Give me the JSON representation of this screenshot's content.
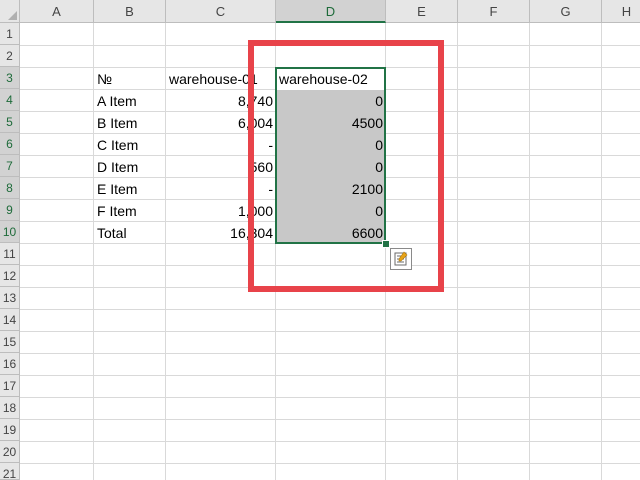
{
  "columns": [
    "A",
    "B",
    "C",
    "D",
    "E",
    "F",
    "G",
    "H"
  ],
  "rows": [
    "1",
    "2",
    "3",
    "4",
    "5",
    "6",
    "7",
    "8",
    "9",
    "10",
    "11",
    "12",
    "13",
    "14",
    "15",
    "16",
    "17",
    "18",
    "19",
    "20",
    "21"
  ],
  "table": {
    "header": {
      "no": "№",
      "col1": "warehouse-01",
      "col2": "warehouse-02"
    },
    "rows": [
      {
        "item": "A Item",
        "w1": "8,740",
        "w2": "0"
      },
      {
        "item": "B Item",
        "w1": "6,004",
        "w2": "4500"
      },
      {
        "item": "C Item",
        "w1": "-",
        "w2": "0"
      },
      {
        "item": "D Item",
        "w1": "560",
        "w2": "0"
      },
      {
        "item": "E Item",
        "w1": "-",
        "w2": "2100"
      },
      {
        "item": "F Item",
        "w1": "1,000",
        "w2": "0"
      },
      {
        "item": "Total",
        "w1": "16,304",
        "w2": "6600"
      }
    ]
  },
  "selection": {
    "column": "D",
    "color": "#217346",
    "fill_color": "#c8c8c8"
  },
  "annotation": {
    "color": "#e8434a"
  },
  "icons": {
    "quick_analysis": "quick-analysis-icon"
  }
}
